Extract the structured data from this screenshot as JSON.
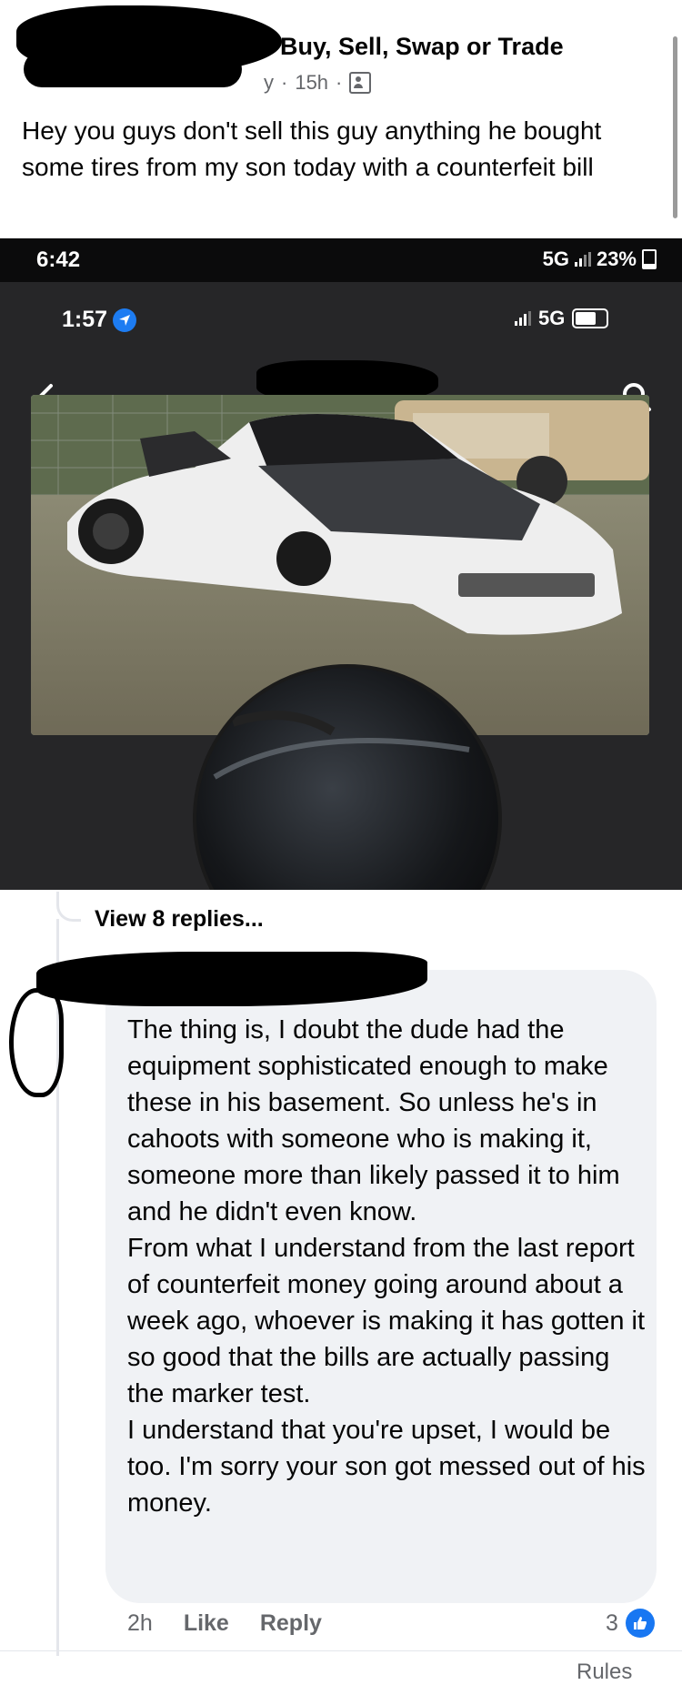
{
  "post": {
    "group_name": "Buy, Sell, Swap or Trade",
    "meta_suffix": "y",
    "time": "15h",
    "separator": "·",
    "text": "Hey you guys don't sell this guy anything he bought some tires from my son today with a counterfeit bill"
  },
  "embedded_screenshot": {
    "outer_status": {
      "time": "6:42",
      "network": "5G",
      "battery": "23%"
    },
    "inner_status": {
      "time": "1:57",
      "network": "5G"
    },
    "icons": {
      "back": "chevron-left-icon",
      "search": "search-icon",
      "location": "location-arrow-icon"
    }
  },
  "comments": {
    "view_replies": "View 8 replies...",
    "comment": {
      "paragraphs": [
        "The thing is, I doubt the dude had the equipment sophisticated enough to make these in his basement. So unless he's in cahoots with someone who is making it, someone more than likely passed it to him and he didn't even know.",
        "From what I understand from the last report of counterfeit money going around about a week ago,  whoever is making it has gotten it so good that the bills are actually passing the marker test.",
        "I understand that you're upset, I would be too. I'm sorry your son got messed out of his money."
      ],
      "time": "2h",
      "like_label": "Like",
      "reply_label": "Reply",
      "reaction_count": "3"
    },
    "footer_link": "Rules"
  },
  "colors": {
    "facebook_blue": "#1877f2",
    "bubble_bg": "#f0f2f5",
    "meta_gray": "#65676b",
    "dark_app_bg": "#262628"
  }
}
